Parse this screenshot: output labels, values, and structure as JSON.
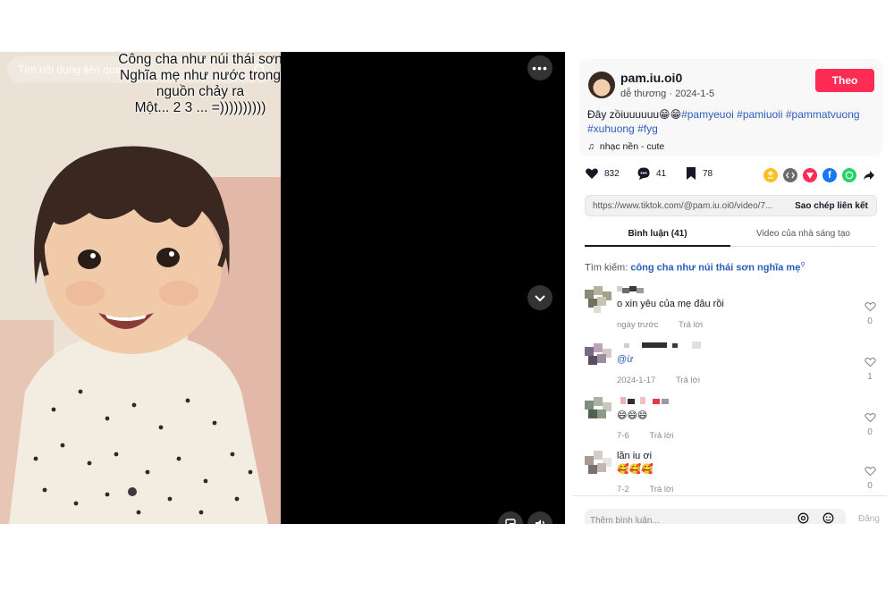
{
  "video": {
    "search_placeholder": "Tìm nội dung liên quan",
    "caption_lines": [
      "Công cha như núi thái sơn",
      "Nghĩa mẹ như nước trong",
      "nguồn chảy ra",
      "Một... 2 3 ... =))))))))))"
    ],
    "more_label": "•••"
  },
  "author": {
    "username": "pam.iu.oi0",
    "nickname": "dễ thương",
    "date": "2024-1-5",
    "follow_label": "Theo",
    "description_text": "Đây zồiuuuuuu😁😁",
    "hashtags": [
      "#pamyeuoi",
      "#pamiuoii",
      "#pammatvuong",
      "#xuhuong",
      "#fyg"
    ],
    "music": "nhạc nền - cute"
  },
  "stats": {
    "likes": "832",
    "comments": "41",
    "saves": "78"
  },
  "share_icons": [
    "repost-icon",
    "embed-icon",
    "send-icon",
    "facebook-icon",
    "whatsapp-icon",
    "share-arrow-icon"
  ],
  "link": {
    "url": "https://www.tiktok.com/@pam.iu.oi0/video/7...",
    "copy_label": "Sao chép liên kết"
  },
  "tabs": {
    "comments_label": "Bình luận (41)",
    "creator_label": "Video của nhà sáng tạo"
  },
  "search_suggest": {
    "prefix": "Tìm kiếm:",
    "query": "công cha như núi thái sơn nghĩa mẹ"
  },
  "comments": [
    {
      "text": "o xin yêu của mẹ đâu rồi",
      "meta": "ngày trước",
      "reply": "Trả lời",
      "likes": "0"
    },
    {
      "text": "@ừ",
      "meta": "2024-1-17",
      "reply": "Trả lời",
      "likes": "1"
    },
    {
      "text": "😄😄😄",
      "meta": "7-6",
      "reply": "Trả lời",
      "likes": "0"
    },
    {
      "name": "lần iu ơi",
      "text": "🥰🥰🥰",
      "meta": "7-2",
      "reply": "Trả lời",
      "likes": "0"
    }
  ],
  "comment_input": {
    "placeholder": "Thêm bình luận...",
    "post_label": "Đăng"
  },
  "colors": {
    "follow": "#fe2c55",
    "hashtag": "#2b5db9",
    "facebook": "#1877f2",
    "whatsapp": "#25d366"
  }
}
